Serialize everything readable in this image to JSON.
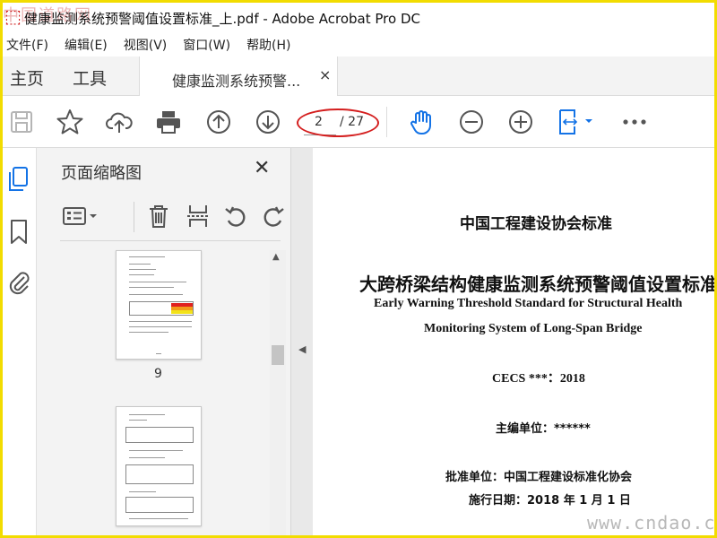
{
  "window": {
    "title": "健康监测系统预警阈值设置标准_上.pdf - Adobe Acrobat Pro DC"
  },
  "watermark": {
    "top": "中国道路网",
    "bottom": "www.cndao.com"
  },
  "menu": [
    "文件(F)",
    "编辑(E)",
    "视图(V)",
    "窗口(W)",
    "帮助(H)"
  ],
  "tabs": {
    "home": "主页",
    "tools": "工具",
    "doc": "健康监测系统预警...",
    "close": "×"
  },
  "toolbar": {
    "page_current": "2",
    "page_total": "/ 27",
    "icons": [
      "save-icon",
      "star-icon",
      "cloud-upload-icon",
      "printer-icon",
      "prev-page-icon",
      "next-page-icon",
      "hand-icon",
      "zoom-out-icon",
      "zoom-in-icon",
      "fit-page-icon",
      "more-icon"
    ],
    "accent_color": "#1473e6",
    "highlight_color": "#d41e1e"
  },
  "panel": {
    "title": "页面缩略图",
    "close": "✕",
    "thumbnails": [
      {
        "label": "9"
      },
      {
        "label": ""
      }
    ]
  },
  "document": {
    "org": "中国工程建设协会标准",
    "title_cn": "大跨桥梁结构健康监测系统预警阈值设置标准",
    "title_en_1": "Early Warning Threshold Standard for Structural Health",
    "title_en_2": "Monitoring System of Long-Span Bridge",
    "code": "CECS ***：2018",
    "editor": "主编单位：******",
    "approver": "批准单位：中国工程建设标准化协会",
    "date": "施行日期：2018 年 1 月 1 日"
  }
}
